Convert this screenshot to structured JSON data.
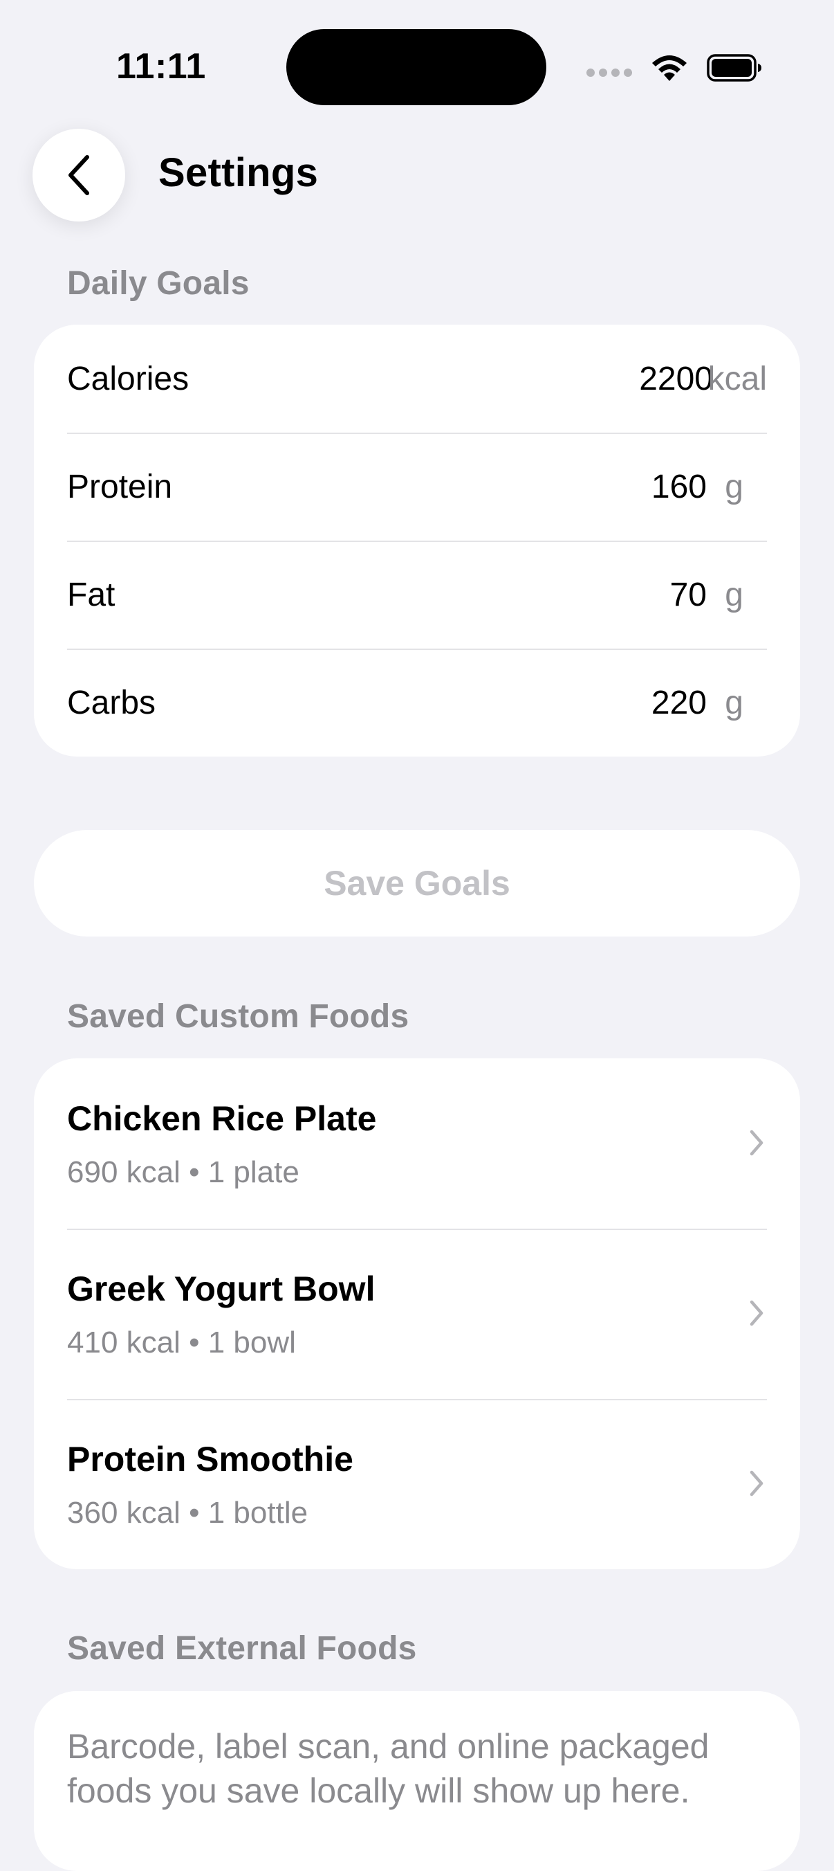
{
  "status_bar": {
    "time": "11:11"
  },
  "nav": {
    "title": "Settings"
  },
  "daily_goals": {
    "header": "Daily Goals",
    "rows": [
      {
        "label": "Calories",
        "value": "2200",
        "unit": "kcal"
      },
      {
        "label": "Protein",
        "value": "160",
        "unit": "g"
      },
      {
        "label": "Fat",
        "value": "70",
        "unit": "g"
      },
      {
        "label": "Carbs",
        "value": "220",
        "unit": "g"
      }
    ],
    "save_label": "Save Goals"
  },
  "custom_foods": {
    "header": "Saved Custom Foods",
    "items": [
      {
        "name": "Chicken Rice Plate",
        "meta": "690 kcal • 1 plate"
      },
      {
        "name": "Greek Yogurt Bowl",
        "meta": "410 kcal • 1 bowl"
      },
      {
        "name": "Protein Smoothie",
        "meta": "360 kcal • 1 bottle"
      }
    ]
  },
  "external_foods": {
    "header": "Saved External Foods",
    "empty_text": "Barcode, label scan, and online packaged foods you save locally will show up here."
  },
  "colors": {
    "background": "#f2f2f7",
    "card": "#ffffff",
    "secondary_text": "#8a8a8e",
    "disabled_text": "#c2c2c6",
    "separator": "#e3e3e6"
  },
  "icons": {
    "back": "chevron-left-icon",
    "row_disclosure": "chevron-right-icon",
    "wifi": "wifi-icon",
    "battery": "battery-icon",
    "signal": "cellular-signal-icon"
  }
}
